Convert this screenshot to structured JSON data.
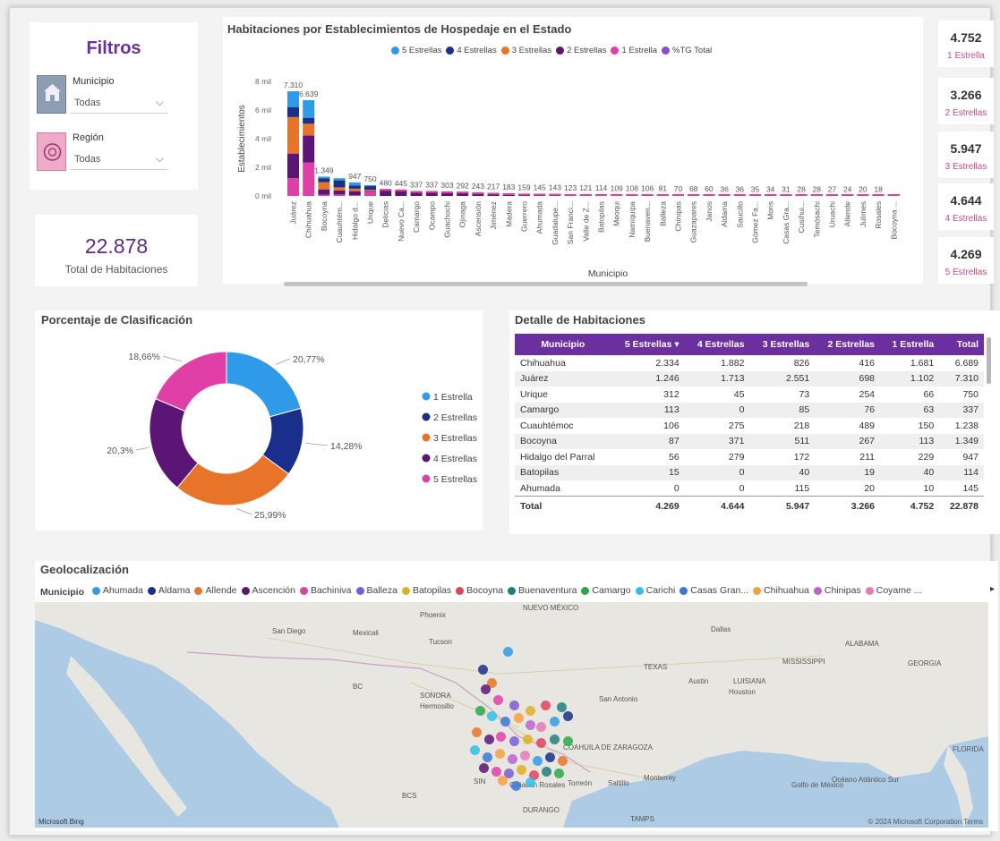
{
  "filters": {
    "title": "Filtros",
    "municipio_label": "Municipio",
    "municipio_value": "Todas",
    "region_label": "Región",
    "region_value": "Todas"
  },
  "total": {
    "value": "22.878",
    "label": "Total de Habitaciones"
  },
  "kpis": [
    {
      "value": "4.752",
      "label": "1 Estrella"
    },
    {
      "value": "3.266",
      "label": "2 Estrellas"
    },
    {
      "value": "5.947",
      "label": "3 Estrellas"
    },
    {
      "value": "4.644",
      "label": "4 Estrellas"
    },
    {
      "value": "4.269",
      "label": "5 Estrellas"
    }
  ],
  "colors": {
    "accent": "#6b2fa0",
    "estrella1": "#2f9be8",
    "estrella2": "#1a2e8c",
    "estrella3": "#e8742a",
    "estrella4": "#5a1575",
    "estrella5": "#e03fa6",
    "pct": "#8a4bd0"
  },
  "chart_data": [
    {
      "type": "bar",
      "title": "Habitaciones por Establecimientos de Hospedaje en el Estado",
      "xlabel": "Municipio",
      "ylabel": "Establecimientos",
      "ylim": [
        0,
        8000
      ],
      "yticks": [
        "0 mil",
        "2 mil",
        "4 mil",
        "6 mil",
        "8 mil"
      ],
      "legend": [
        "5 Estrellas",
        "4 Estrellas",
        "3 Estrellas",
        "2 Estrellas",
        "1 Estrella",
        "%TG Total"
      ],
      "categories": [
        "Juárez",
        "Chihuahua",
        "Bocoyna",
        "Cuauhtém...",
        "Hidalgo d...",
        "Urique",
        "Delicias",
        "Nuevo Ca...",
        "Camargo",
        "Ocampo",
        "Guachochi",
        "Ojinaga",
        "Ascensión",
        "Jiménez",
        "Madera",
        "Guerrero",
        "Ahumada",
        "Guadalupe...",
        "San Franci...",
        "Valle de Z...",
        "Batopilas",
        "Meoqui",
        "Namiquipa",
        "Buenaven...",
        "Balleza",
        "Chínipas",
        "Guazapares",
        "Janos",
        "Aldama",
        "Saucillo",
        "Gómez Fa...",
        "Moris",
        "Casas Gra...",
        "Cusihui...",
        "Temósachi",
        "Uruachi",
        "Allende",
        "Julimes",
        "Rosales",
        "Bocoyna ..."
      ],
      "labels": [
        "7.310",
        "6.639",
        "1.349",
        "",
        "947",
        "750",
        "480",
        "445",
        "337",
        "337",
        "303",
        "292",
        "243",
        "217",
        "183",
        "159",
        "145",
        "143",
        "123",
        "121",
        "114",
        "109",
        "108",
        "106",
        "81",
        "70",
        "68",
        "60",
        "36",
        "36",
        "35",
        "34",
        "31",
        "28",
        "28",
        "27",
        "24",
        "20",
        "18",
        ""
      ],
      "totals": [
        7310,
        6689,
        1349,
        1238,
        947,
        750,
        480,
        445,
        337,
        337,
        303,
        292,
        243,
        217,
        183,
        159,
        145,
        143,
        123,
        121,
        114,
        109,
        108,
        106,
        81,
        70,
        68,
        60,
        36,
        36,
        35,
        34,
        31,
        28,
        28,
        27,
        24,
        20,
        18,
        12
      ],
      "series": [
        {
          "name": "5 Estrellas",
          "values": [
            1246,
            2334,
            87,
            106,
            56,
            312
          ]
        },
        {
          "name": "4 Estrellas",
          "values": [
            1713,
            1882,
            371,
            275,
            279,
            45
          ]
        },
        {
          "name": "3 Estrellas",
          "values": [
            2551,
            826,
            511,
            218,
            172,
            73
          ]
        },
        {
          "name": "2 Estrellas",
          "values": [
            698,
            416,
            267,
            489,
            211,
            254
          ]
        },
        {
          "name": "1 Estrella",
          "values": [
            1102,
            1231,
            113,
            150,
            229,
            66
          ]
        }
      ]
    },
    {
      "type": "pie",
      "title": "Porcentaje de Clasificación",
      "categories": [
        "1 Estrella",
        "2 Estrellas",
        "3 Estrellas",
        "4 Estrellas",
        "5 Estrellas"
      ],
      "values": [
        20.77,
        14.28,
        25.99,
        20.3,
        18.66
      ],
      "labels": [
        "20,77%",
        "14,28%",
        "25,99%",
        "20,3%",
        "18,66%"
      ]
    },
    {
      "type": "table",
      "title": "Detalle de Habitaciones",
      "columns": [
        "Municipio",
        "5 Estrellas",
        "4 Estrellas",
        "3 Estrellas",
        "2 Estrellas",
        "1 Estrella",
        "Total"
      ],
      "rows": [
        [
          "Chihuahua",
          "2.334",
          "1.882",
          "826",
          "416",
          "1.681",
          "6.689"
        ],
        [
          "Juárez",
          "1.246",
          "1.713",
          "2.551",
          "698",
          "1.102",
          "7.310"
        ],
        [
          "Urique",
          "312",
          "45",
          "73",
          "254",
          "66",
          "750"
        ],
        [
          "Camargo",
          "113",
          "0",
          "85",
          "76",
          "63",
          "337"
        ],
        [
          "Cuauhtémoc",
          "106",
          "275",
          "218",
          "489",
          "150",
          "1.238"
        ],
        [
          "Bocoyna",
          "87",
          "371",
          "511",
          "267",
          "113",
          "1.349"
        ],
        [
          "Hidalgo del Parral",
          "56",
          "279",
          "172",
          "211",
          "229",
          "947"
        ],
        [
          "Batopilas",
          "15",
          "0",
          "40",
          "19",
          "40",
          "114"
        ],
        [
          "Ahumada",
          "0",
          "0",
          "115",
          "20",
          "10",
          "145"
        ]
      ],
      "footer": [
        "Total",
        "4.269",
        "4.644",
        "5.947",
        "3.266",
        "4.752",
        "22.878"
      ]
    }
  ],
  "geo": {
    "title": "Geolocalización",
    "legend_title": "Municipio",
    "legend": [
      {
        "name": "Ahumada",
        "color": "#2f9be8"
      },
      {
        "name": "Aldama",
        "color": "#1a2e8c"
      },
      {
        "name": "Allende",
        "color": "#e8742a"
      },
      {
        "name": "Ascención",
        "color": "#5a1575"
      },
      {
        "name": "Bachiniva",
        "color": "#e03fa6"
      },
      {
        "name": "Balleza",
        "color": "#7b5cd6"
      },
      {
        "name": "Batopilas",
        "color": "#e0b020"
      },
      {
        "name": "Bocoyna",
        "color": "#e0445a"
      },
      {
        "name": "Buenaventura",
        "color": "#1e7f7f"
      },
      {
        "name": "Camargo",
        "color": "#2aa84a"
      },
      {
        "name": "Carichi",
        "color": "#2fc0e8"
      },
      {
        "name": "Casas Gran...",
        "color": "#3a78d8"
      },
      {
        "name": "Chihuahua",
        "color": "#f4a040"
      },
      {
        "name": "Chinipas",
        "color": "#c060d0"
      },
      {
        "name": "Coyame ...",
        "color": "#e878b8"
      }
    ],
    "map_labels": [
      {
        "text": "NUEVO MÉXICO"
      },
      {
        "text": "Phoenix"
      },
      {
        "text": "San Diego"
      },
      {
        "text": "Mexicali"
      },
      {
        "text": "Tucson"
      },
      {
        "text": "Dallas"
      },
      {
        "text": "ALABAMA"
      },
      {
        "text": "TEXAS"
      },
      {
        "text": "MISSISSIPPI"
      },
      {
        "text": "GEORGIA"
      },
      {
        "text": "Austin"
      },
      {
        "text": "San Antonio"
      },
      {
        "text": "Houston"
      },
      {
        "text": "LUISIANA"
      },
      {
        "text": "SONORA"
      },
      {
        "text": "Hermosillo"
      },
      {
        "text": "COAHUILA DE ZARAGOZA"
      },
      {
        "text": "Monterrey"
      },
      {
        "text": "Torreón"
      },
      {
        "text": "Saltillo"
      },
      {
        "text": "Culiacán Rosales"
      },
      {
        "text": "DURANGO"
      },
      {
        "text": "Golfo de México"
      },
      {
        "text": "Océano Atlántico Sur"
      },
      {
        "text": "FLORIDA"
      },
      {
        "text": "BC"
      },
      {
        "text": "BCS"
      },
      {
        "text": "SIN"
      },
      {
        "text": "TAMPS"
      }
    ],
    "attribution_left": "Microsoft Bing",
    "attribution_right": "© 2024 Microsoft Corporation  Terms"
  }
}
